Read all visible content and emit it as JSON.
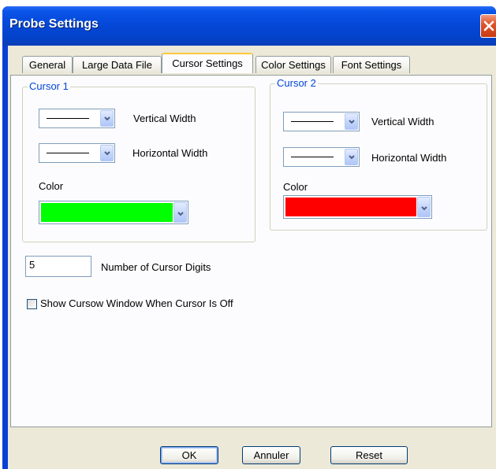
{
  "window": {
    "title": "Probe Settings",
    "close_icon": "close-icon"
  },
  "tabs": [
    {
      "label": "General"
    },
    {
      "label": "Large Data File"
    },
    {
      "label": "Cursor Settings",
      "active": true
    },
    {
      "label": "Color Settings"
    },
    {
      "label": "Font Settings"
    }
  ],
  "cursor1": {
    "legend": "Cursor 1",
    "vertical_width_label": "Vertical Width",
    "horizontal_width_label": "Horizontal Width",
    "color_label": "Color",
    "color_value": "#00ff00"
  },
  "cursor2": {
    "legend": "Cursor 2",
    "vertical_width_label": "Vertical Width",
    "horizontal_width_label": "Horizontal Width",
    "color_label": "Color",
    "color_value": "#ff0000"
  },
  "digits": {
    "value": "5",
    "label": "Number of Cursor Digits"
  },
  "show_window": {
    "label": "Show Cursow Window When Cursor Is Off",
    "checked": false
  },
  "buttons": {
    "ok": "OK",
    "cancel": "Annuler",
    "reset": "Reset"
  }
}
